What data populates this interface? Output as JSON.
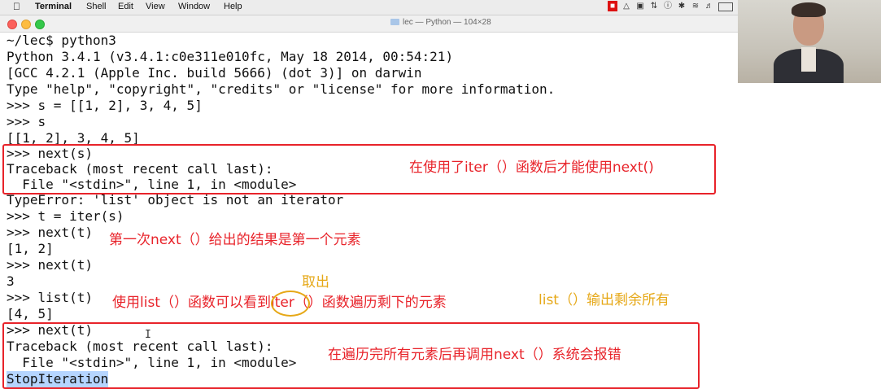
{
  "menubar": {
    "app": "Terminal",
    "items": [
      "Shell",
      "Edit",
      "View",
      "Window",
      "Help"
    ]
  },
  "window": {
    "title": "lec — Python — 104×28"
  },
  "terminal": {
    "lines": [
      "~/lec$ python3",
      "Python 3.4.1 (v3.4.1:c0e311e010fc, May 18 2014, 00:54:21)",
      "[GCC 4.2.1 (Apple Inc. build 5666) (dot 3)] on darwin",
      "Type \"help\", \"copyright\", \"credits\" or \"license\" for more information.",
      ">>> s = [[1, 2], 3, 4, 5]",
      ">>> s",
      "[[1, 2], 3, 4, 5]",
      ">>> next(s)",
      "Traceback (most recent call last):",
      "  File \"<stdin>\", line 1, in <module>",
      "TypeError: 'list' object is not an iterator",
      ">>> t = iter(s)",
      ">>> next(t)",
      "[1, 2]",
      ">>> next(t)",
      "3",
      ">>> list(t)",
      "[4, 5]",
      ">>> next(t)",
      "Traceback (most recent call last):",
      "  File \"<stdin>\", line 1, in <module>",
      "StopIteration"
    ]
  },
  "annotations": {
    "box1_note": "在使用了iter（）函数后才能使用next()",
    "note2": "第一次next（）给出的结果是第一个元素",
    "take_out": "取出",
    "note3": "使用list（）函数可以看到iter（）函数遍历剩下的元素",
    "note4": "list（）输出剩余所有",
    "box2_note": "在遍历完所有元素后再调用next（）系统会报错"
  },
  "colors": {
    "annotation_red": "#e8232a",
    "annotation_yellow": "#e6a817",
    "selection": "#b5d5ff"
  }
}
